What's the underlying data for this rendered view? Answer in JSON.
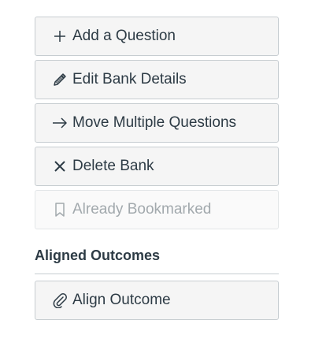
{
  "actions": {
    "add_question": {
      "label": "Add a Question",
      "icon": "plus-icon"
    },
    "edit_bank": {
      "label": "Edit Bank Details",
      "icon": "pencil-icon"
    },
    "move_questions": {
      "label": "Move Multiple Questions",
      "icon": "arrow-right-icon"
    },
    "delete_bank": {
      "label": "Delete Bank",
      "icon": "x-icon"
    },
    "bookmark": {
      "label": "Already Bookmarked",
      "icon": "bookmark-icon",
      "disabled": true
    }
  },
  "aligned_outcomes": {
    "title": "Aligned Outcomes",
    "align_button": {
      "label": "Align Outcome",
      "icon": "paperclip-icon"
    }
  },
  "colors": {
    "button_bg": "#f5f5f5",
    "button_border": "#c7cdd1",
    "text": "#2d3b45",
    "disabled_text": "#a2a9ad"
  }
}
